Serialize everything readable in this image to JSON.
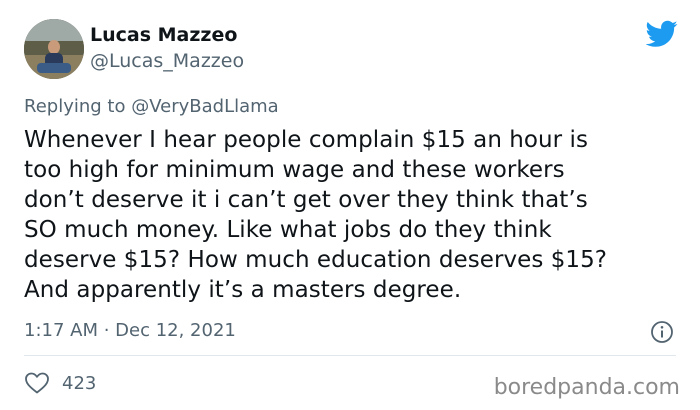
{
  "author": {
    "display_name": "Lucas Mazzeo",
    "handle": "@Lucas_Mazzeo",
    "avatar_icon": "avatar-photo"
  },
  "reply": {
    "prefix": "Replying to",
    "mention": "@VeryBadLlama"
  },
  "tweet": {
    "text": "Whenever I hear people complain $15 an hour is\ntoo high for minimum wage and these workers\ndon’t deserve it i can’t get over they think that’s\nSO much money. Like what jobs do they think\ndeserve $15? How much education deserves $15?\nAnd apparently it’s a masters degree.",
    "timestamp": "1:17 AM · Dec 12, 2021"
  },
  "engagement": {
    "like_count": "423",
    "like_icon": "heart-outline-icon",
    "info_icon": "info-icon"
  },
  "brand": {
    "logo_icon": "twitter-bird-icon",
    "twitter_color": "#1d9bf0",
    "watermark": "boredpanda.com"
  }
}
